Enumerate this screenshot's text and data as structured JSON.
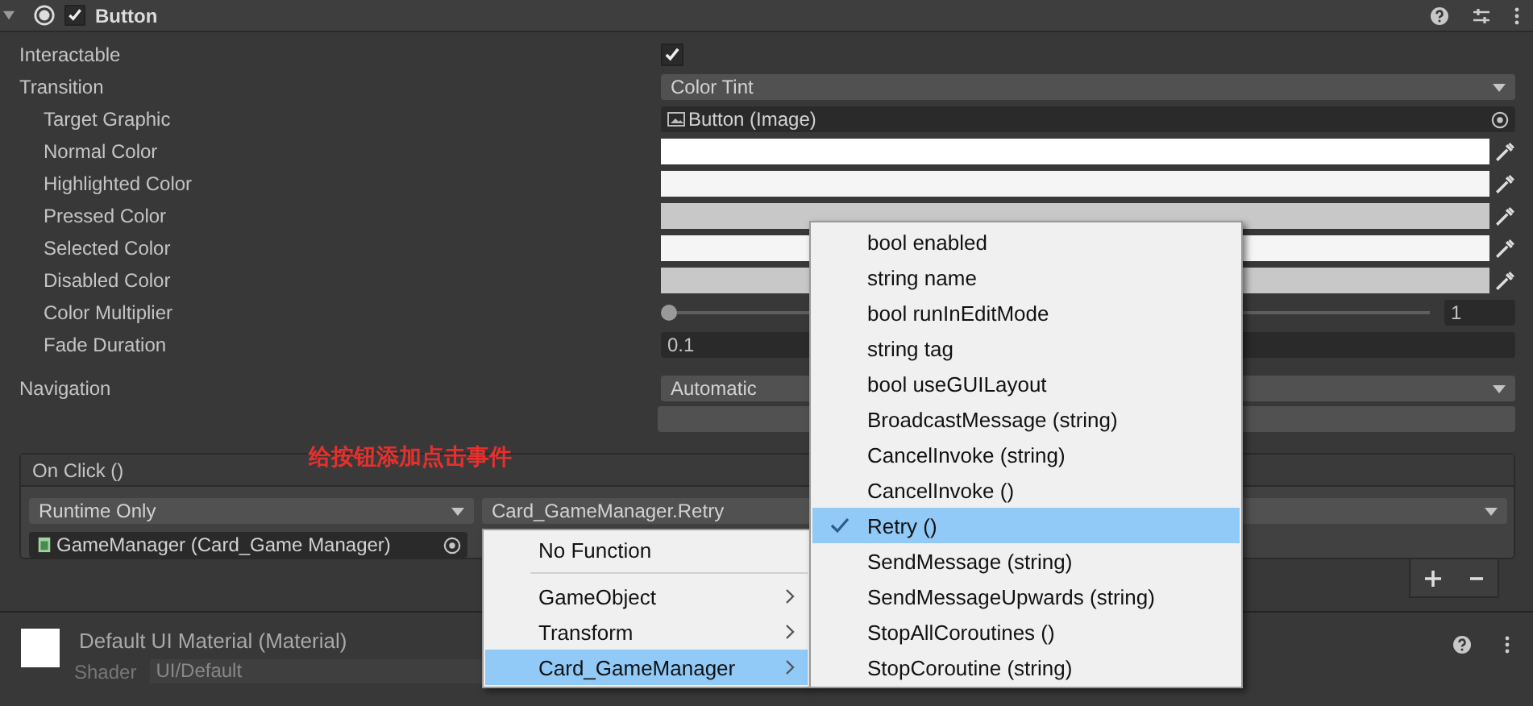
{
  "component": {
    "title": "Button",
    "enabled": true
  },
  "fields": [
    {
      "label": "Interactable",
      "kind": "checkbox",
      "checked": true
    },
    {
      "label": "Transition",
      "kind": "dropdown",
      "value": "Color Tint",
      "children": [
        {
          "label": "Target Graphic",
          "kind": "object",
          "value": "Button (Image)"
        },
        {
          "label": "Normal Color",
          "kind": "color",
          "color": "#ffffff"
        },
        {
          "label": "Highlighted Color",
          "kind": "color",
          "color": "#f5f5f5"
        },
        {
          "label": "Pressed Color",
          "kind": "color",
          "color": "#c8c8c8"
        },
        {
          "label": "Selected Color",
          "kind": "color",
          "color": "#f5f5f5"
        },
        {
          "label": "Disabled Color",
          "kind": "color",
          "color": "#c8c8c8"
        },
        {
          "label": "Color Multiplier",
          "kind": "slider",
          "level": 0,
          "value": "1"
        },
        {
          "label": "Fade Duration",
          "kind": "number",
          "value": "0.1"
        }
      ]
    },
    {
      "label": "Navigation",
      "kind": "dropdown",
      "value": "Automatic"
    }
  ],
  "on_click": {
    "title": "On Click ()",
    "annotation": "给按钮添加点击事件",
    "mode": "Runtime Only",
    "function": "Card_GameManager.Retry",
    "target": "GameManager (Card_Game Manager)"
  },
  "function_menu": [
    {
      "label": "No Function",
      "kind": "item",
      "selected": false
    },
    {
      "label": "GameObject",
      "kind": "submenu",
      "selected": false
    },
    {
      "label": "Transform",
      "kind": "submenu",
      "selected": false
    },
    {
      "label": "Card_GameManager",
      "kind": "submenu",
      "selected": true
    }
  ],
  "submenu": [
    {
      "label": "bool enabled",
      "checked": false
    },
    {
      "label": "string name",
      "checked": false
    },
    {
      "label": "bool runInEditMode",
      "checked": false
    },
    {
      "label": "string tag",
      "checked": false
    },
    {
      "label": "bool useGUILayout",
      "checked": false
    },
    {
      "label": "BroadcastMessage (string)",
      "checked": false
    },
    {
      "label": "CancelInvoke (string)",
      "checked": false
    },
    {
      "label": "CancelInvoke ()",
      "checked": false
    },
    {
      "label": "Retry ()",
      "checked": true
    },
    {
      "label": "SendMessage (string)",
      "checked": false
    },
    {
      "label": "SendMessageUpwards (string)",
      "checked": false
    },
    {
      "label": "StopAllCoroutines ()",
      "checked": false
    },
    {
      "label": "StopCoroutine (string)",
      "checked": false
    }
  ],
  "material": {
    "name": "Default UI Material (Material)",
    "shader_label": "Shader",
    "shader": "UI/Default"
  }
}
